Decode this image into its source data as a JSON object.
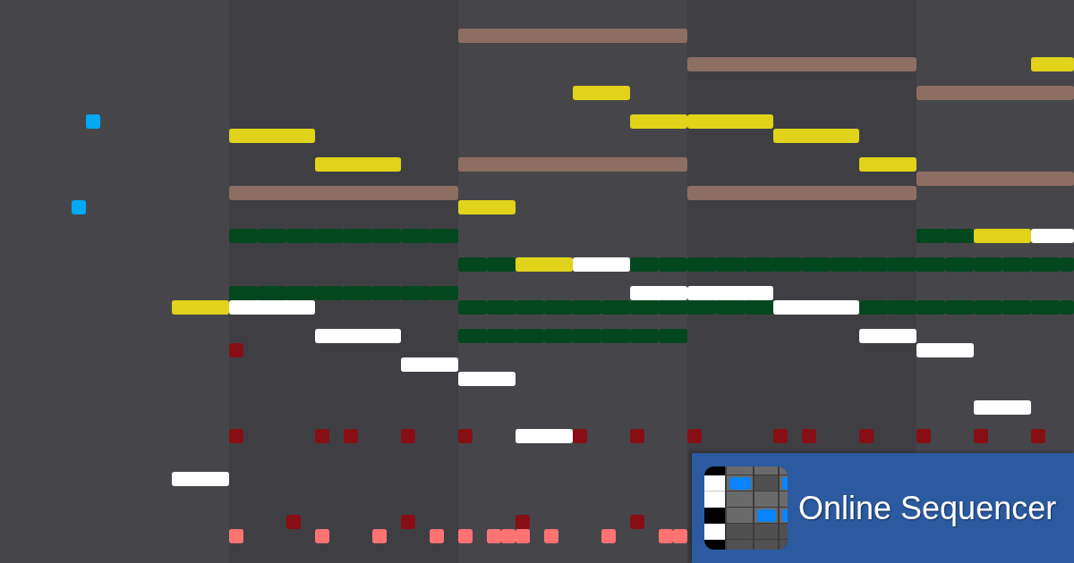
{
  "piano_roll": {
    "tracks": [
      {
        "color": "#e0d319"
      },
      {
        "color": "#8d6e63"
      },
      {
        "color": "#03471f"
      },
      {
        "color": "#ffffff"
      },
      {
        "color": "#03a9f4"
      },
      {
        "color": "#880e16"
      },
      {
        "color": "#ff7373"
      }
    ]
  },
  "logo": {
    "name": "Online Sequencer"
  }
}
